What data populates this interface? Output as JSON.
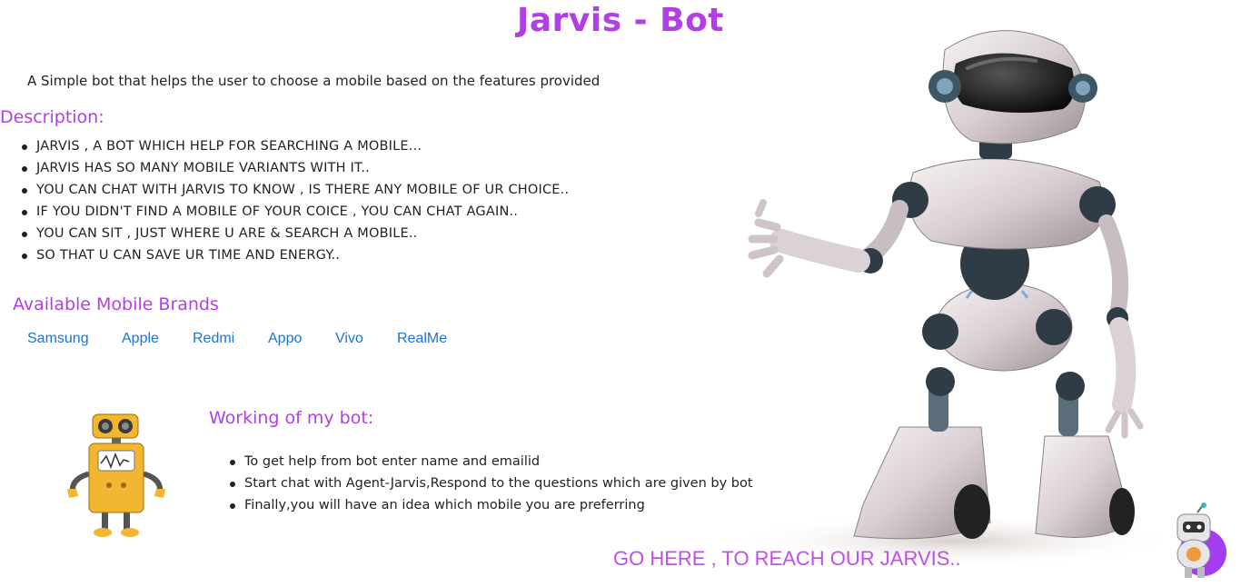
{
  "page": {
    "title": "Jarvis - Bot",
    "subtitle": "A Simple bot that helps the user to choose a mobile based on the features provided"
  },
  "description": {
    "heading": "Description:",
    "items": [
      "JARVIS , A BOT WHICH HELP FOR SEARCHING A MOBILE...",
      "JARVIS HAS SO MANY MOBILE VARIANTS WITH IT..",
      "YOU CAN CHAT WITH JARVIS TO KNOW , IS THERE ANY MOBILE OF UR CHOICE..",
      "IF YOU DIDN'T FIND A MOBILE OF YOUR COICE , YOU CAN CHAT AGAIN..",
      "YOU CAN SIT , JUST WHERE U ARE & SEARCH A MOBILE..",
      "SO THAT U CAN SAVE UR TIME AND ENERGY.."
    ]
  },
  "brands": {
    "heading": "Available Mobile Brands",
    "items": [
      "Samsung",
      "Apple",
      "Redmi",
      "Appo",
      "Vivo",
      "RealMe"
    ]
  },
  "working": {
    "heading": "Working of my bot:",
    "items": [
      "To get help from bot enter name and emailid",
      "Start chat with Agent-Jarvis,Respond to the questions which are given by bot",
      "Finally,you will have an idea which mobile you are preferring"
    ]
  },
  "cta": {
    "label": "GO HERE , TO REACH OUR JARVIS.."
  },
  "colors": {
    "accent": "#b23fe3",
    "link": "#1b73d6",
    "cta": "#c04fe8",
    "launcher": "#a43cf0"
  },
  "icons": {
    "hero": "robot-illustration",
    "small": "yellow-robot-icon",
    "launcher": "chatbot-launcher-icon"
  }
}
